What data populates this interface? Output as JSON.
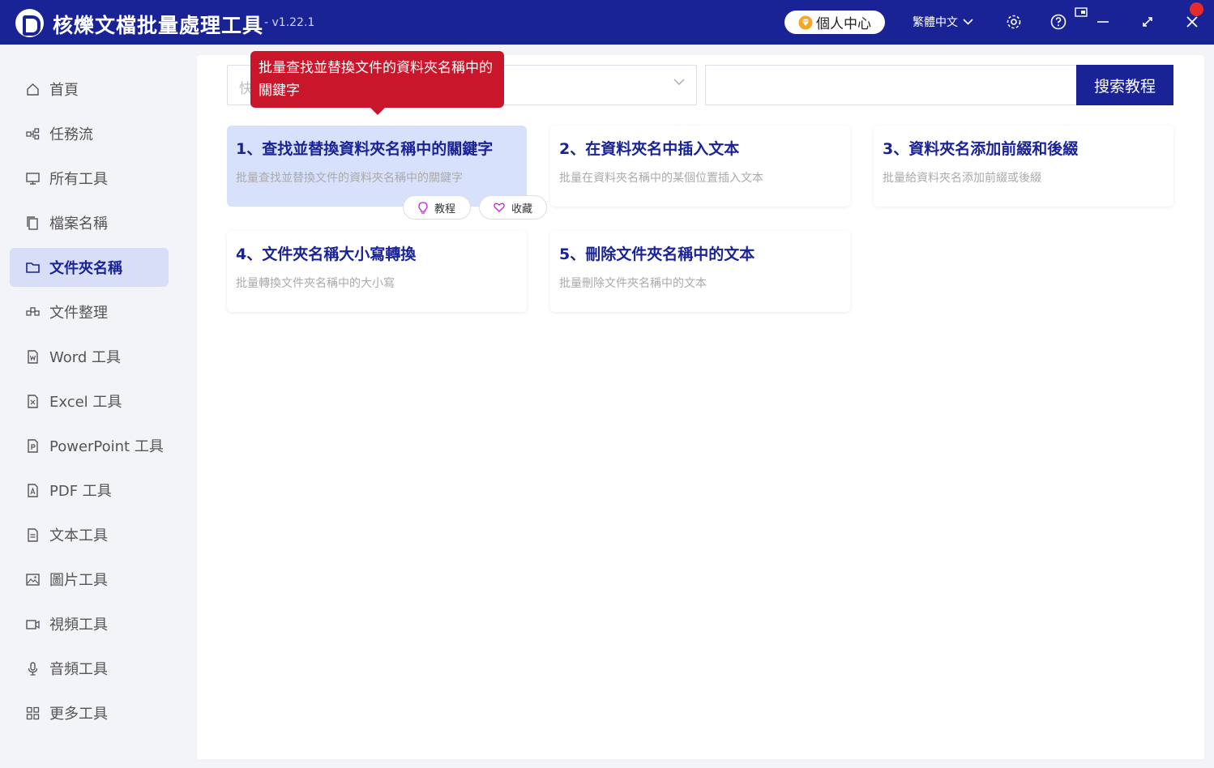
{
  "app": {
    "title": "核爍文檔批量處理工具",
    "version": "- v1.22.1",
    "user_center": "個人中心",
    "language": "繁體中文"
  },
  "sidebar": {
    "items": [
      {
        "label": "首頁",
        "icon": "home-icon"
      },
      {
        "label": "任務流",
        "icon": "workflow-icon"
      },
      {
        "label": "所有工具",
        "icon": "monitor-icon"
      },
      {
        "label": "檔案名稱",
        "icon": "file-copy-icon"
      },
      {
        "label": "文件夾名稱",
        "icon": "folder-icon",
        "active": true
      },
      {
        "label": "文件整理",
        "icon": "organize-icon"
      },
      {
        "label": "Word 工具",
        "icon": "word-file-icon"
      },
      {
        "label": "Excel 工具",
        "icon": "excel-file-icon"
      },
      {
        "label": "PowerPoint 工具",
        "icon": "ppt-file-icon"
      },
      {
        "label": "PDF 工具",
        "icon": "pdf-file-icon"
      },
      {
        "label": "文本工具",
        "icon": "text-file-icon"
      },
      {
        "label": "圖片工具",
        "icon": "image-icon"
      },
      {
        "label": "視頻工具",
        "icon": "video-icon"
      },
      {
        "label": "音頻工具",
        "icon": "microphone-icon"
      },
      {
        "label": "更多工具",
        "icon": "grid-icon"
      }
    ]
  },
  "search": {
    "quick_placeholder": "快",
    "button_label": "搜索教程",
    "query": ""
  },
  "tooltip": {
    "text": "批量查找並替換文件的資料夾名稱中的關鍵字"
  },
  "cards": [
    {
      "title": "1、查找並替換資料夾名稱中的關鍵字",
      "desc": "批量查找並替換文件的資料夾名稱中的關鍵字"
    },
    {
      "title": "2、在資料夾名中插入文本",
      "desc": "批量在資料夾名稱中的某個位置插入文本"
    },
    {
      "title": "3、資料夾名添加前綴和後綴",
      "desc": "批量給資料夾名添加前綴或後綴"
    },
    {
      "title": "4、文件夾名稱大小寫轉換",
      "desc": "批量轉換文件夾名稱中的大小寫"
    },
    {
      "title": "5、刪除文件夾名稱中的文本",
      "desc": "批量刪除文件夾名稱中的文本"
    }
  ],
  "card_actions": {
    "tutorial": "教程",
    "favorite": "收藏"
  },
  "colors": {
    "brand": "#1a2396",
    "tooltip": "#c9162b",
    "active_card": "#d8e1fb"
  }
}
